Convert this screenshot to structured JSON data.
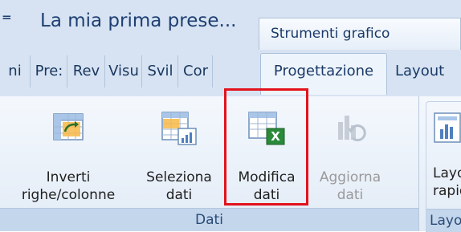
{
  "titlebar": {
    "document_title": "La mia prima prese...",
    "context_tab_header": "Strumenti grafico"
  },
  "tabs": [
    {
      "label": "ni"
    },
    {
      "label": "Pre:"
    },
    {
      "label": "Rev"
    },
    {
      "label": "Visu"
    },
    {
      "label": "Svil"
    },
    {
      "label": "Cor"
    },
    {
      "label": "Progettazione"
    },
    {
      "label": "Layout"
    }
  ],
  "ribbon": {
    "group_dati": {
      "label": "Dati",
      "buttons": [
        {
          "line1": "Inverti",
          "line2": "righe/colonne",
          "icon": "switch-rows-columns-icon",
          "enabled": true
        },
        {
          "line1": "Seleziona",
          "line2": "dati",
          "icon": "select-data-icon",
          "enabled": true
        },
        {
          "line1": "Modifica",
          "line2": "dati",
          "icon": "edit-data-excel-icon",
          "enabled": true
        },
        {
          "line1": "Aggiorna",
          "line2": "dati",
          "icon": "refresh-data-icon",
          "enabled": false
        }
      ]
    },
    "group_layout": {
      "label": "Layout",
      "button": {
        "line1": "Layou",
        "line2": "rapido",
        "icon": "quick-layout-icon"
      }
    }
  },
  "colors": {
    "highlight": "#e3121c",
    "excel_green": "#2a8a3a"
  }
}
